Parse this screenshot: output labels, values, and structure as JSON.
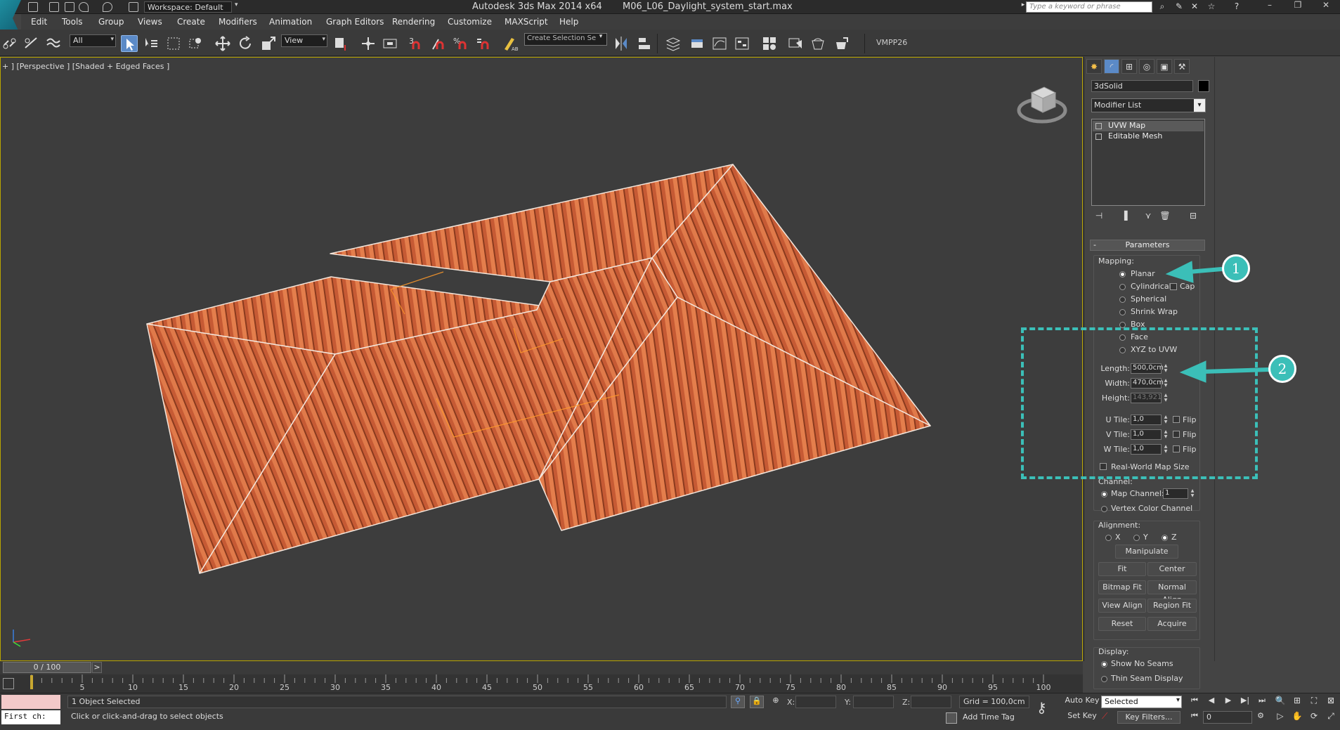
{
  "titlebar": {
    "workspace": "Workspace: Default",
    "app_title": "Autodesk 3ds Max  2014 x64",
    "file_name": "M06_L06_Daylight_system_start.max",
    "search_placeholder": "Type a keyword or phrase"
  },
  "menu": [
    "Edit",
    "Tools",
    "Group",
    "Views",
    "Create",
    "Modifiers",
    "Animation",
    "Graph Editors",
    "Rendering",
    "Customize",
    "MAXScript",
    "Help"
  ],
  "toolbar": {
    "selection_filter": "All",
    "reference_coord": "View",
    "named_selection_placeholder": "Create Selection Se",
    "vmpp_label": "VMPP26"
  },
  "viewport": {
    "label": "+ ] [Perspective ] [Shaded + Edged Faces ]",
    "roof_color": "#c9613a"
  },
  "command_panel": {
    "object_name": "3dSolid",
    "modifier_list": "Modifier List",
    "stack": [
      {
        "label": "UVW Map",
        "selected": true
      },
      {
        "label": "Editable Mesh",
        "selected": false
      }
    ],
    "rollout_title": "Parameters",
    "mapping_label": "Mapping:",
    "mapping_options": [
      "Planar",
      "Cylindrical",
      "Spherical",
      "Shrink Wrap",
      "Box",
      "Face",
      "XYZ to UVW"
    ],
    "mapping_selected": "Planar",
    "cap_label": "Cap",
    "length_label": "Length:",
    "length_value": "500,0cm",
    "width_label": "Width:",
    "width_value": "470,0cm",
    "height_label": "Height:",
    "height_value": "143,921",
    "u_tile_label": "U Tile:",
    "u_tile_value": "1,0",
    "v_tile_label": "V Tile:",
    "v_tile_value": "1,0",
    "w_tile_label": "W Tile:",
    "w_tile_value": "1,0",
    "flip_label": "Flip",
    "real_world_label": "Real-World Map Size",
    "channel_label": "Channel:",
    "map_channel_label": "Map Channel:",
    "map_channel_value": "1",
    "vertex_color_label": "Vertex Color Channel",
    "alignment_label": "Alignment:",
    "axis_x": "X",
    "axis_y": "Y",
    "axis_z": "Z",
    "manipulate": "Manipulate",
    "fit": "Fit",
    "center": "Center",
    "bitmap_fit": "Bitmap Fit",
    "normal_align": "Normal Align",
    "view_align": "View Align",
    "region_fit": "Region Fit",
    "reset": "Reset",
    "acquire": "Acquire",
    "display_label": "Display:",
    "show_no_seams": "Show No Seams",
    "thin_seam": "Thin Seam Display"
  },
  "annotations": {
    "callout1": "1",
    "callout2": "2",
    "color": "#3bbfb8"
  },
  "timeline": {
    "position": "0 / 100",
    "next": ">",
    "ticks": [
      "5",
      "10",
      "15",
      "20",
      "25",
      "30",
      "35",
      "40",
      "45",
      "50",
      "55",
      "60",
      "65",
      "70",
      "75",
      "80",
      "85",
      "90",
      "95",
      "100"
    ]
  },
  "status": {
    "listener_text": "First ch:",
    "line1": "1 Object Selected",
    "line2": "Click or click-and-drag to select objects",
    "x_label": "X:",
    "y_label": "Y:",
    "z_label": "Z:",
    "grid": "Grid = 100,0cm",
    "add_time_tag": "Add Time Tag",
    "auto_key": "Auto Key",
    "set_key": "Set Key",
    "selected_dd": "Selected",
    "key_filters": "Key Filters...",
    "frame": "0"
  }
}
